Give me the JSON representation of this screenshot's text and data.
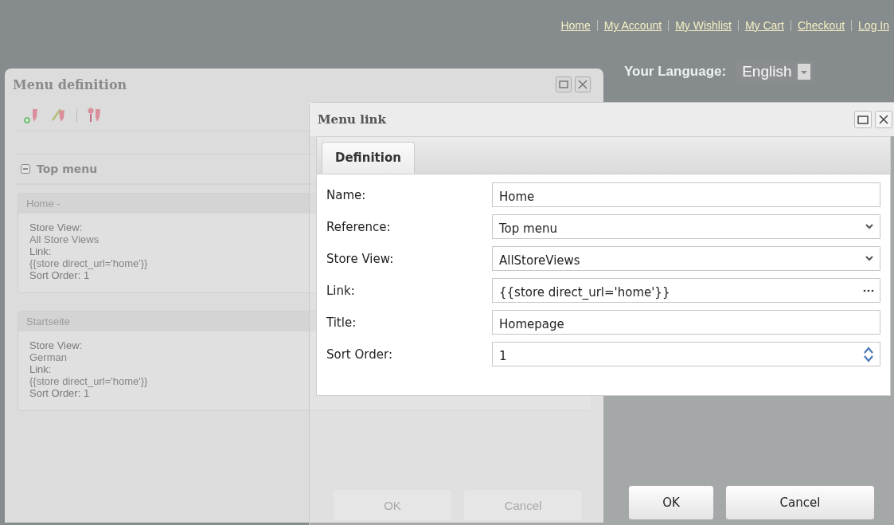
{
  "top_links": [
    "Home",
    "My Account",
    "My Wishlist",
    "My Cart",
    "Checkout",
    "Log In"
  ],
  "language": {
    "label": "Your Language:",
    "value": "English"
  },
  "menu_definition": {
    "title": "Menu definition",
    "tree": {
      "label": "Top menu",
      "expanded": true
    },
    "items": [
      {
        "header": "Home -",
        "rows": [
          {
            "kind": "stacked",
            "label": "Store View:",
            "value": "All Store Views"
          },
          {
            "kind": "stacked",
            "label": "Link:",
            "value": "{{store direct_url='home'}}"
          },
          {
            "kind": "inline",
            "label": "Sort Order:",
            "value": "1"
          }
        ]
      },
      {
        "header": "Startseite",
        "rows": [
          {
            "kind": "stacked",
            "label": "Store View:",
            "value": "German"
          },
          {
            "kind": "stacked",
            "label": "Link:",
            "value": "{{store direct_url='home'}}"
          },
          {
            "kind": "inline",
            "label": "Sort Order:",
            "value": "1"
          }
        ]
      }
    ],
    "buttons": [
      "OK",
      "Cancel"
    ]
  },
  "menu_link": {
    "title": "Menu link",
    "tabs": [
      {
        "label": "Definition",
        "selected": true
      }
    ],
    "fields": [
      {
        "kind": "text",
        "label": "Name:",
        "value": "Home"
      },
      {
        "kind": "select",
        "label": "Reference:",
        "value": "Top menu"
      },
      {
        "kind": "select",
        "label": "Store View:",
        "value": "AllStoreViews"
      },
      {
        "kind": "picker",
        "label": "Link:",
        "value": "{{store direct_url='home'}}"
      },
      {
        "kind": "text",
        "label": "Title:",
        "value": "Homepage"
      },
      {
        "kind": "spinner",
        "label": "Sort Order:",
        "value": "1"
      }
    ],
    "buttons": [
      "OK",
      "Cancel"
    ]
  }
}
